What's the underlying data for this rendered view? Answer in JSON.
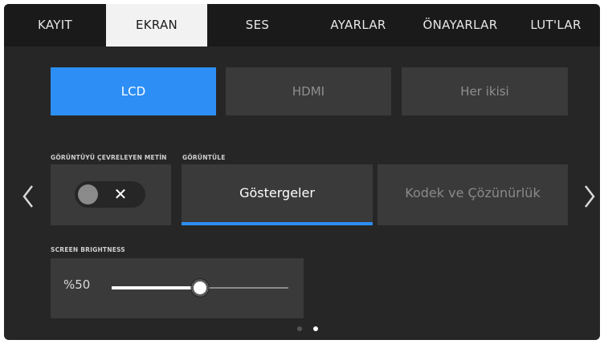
{
  "tabs": [
    {
      "label": "KAYIT",
      "active": false
    },
    {
      "label": "EKRAN",
      "active": true
    },
    {
      "label": "SES",
      "active": false
    },
    {
      "label": "AYARLAR",
      "active": false
    },
    {
      "label": "ÖNAYARLAR",
      "active": false
    },
    {
      "label": "LUT'LAR",
      "active": false
    }
  ],
  "output": {
    "options": [
      "LCD",
      "HDMI",
      "Her ikisi"
    ],
    "selected": "LCD"
  },
  "frame_guide_text": {
    "label": "GÖRÜNTÜYÜ ÇEVRELEYEN METİN",
    "toggle_on": false,
    "toggle_icon": "close-icon"
  },
  "display": {
    "label": "GÖRÜNTÜLE",
    "options": [
      "Göstergeler",
      "Kodek ve Çözünürlük"
    ],
    "selected": "Göstergeler"
  },
  "brightness": {
    "label": "SCREEN BRIGHTNESS",
    "value_text": "%50",
    "value": 0.5
  },
  "pagination": {
    "pages": 2,
    "current": 2
  },
  "colors": {
    "accent": "#2d8ff5",
    "background": "#262626",
    "panel": "#3a3a3a"
  }
}
